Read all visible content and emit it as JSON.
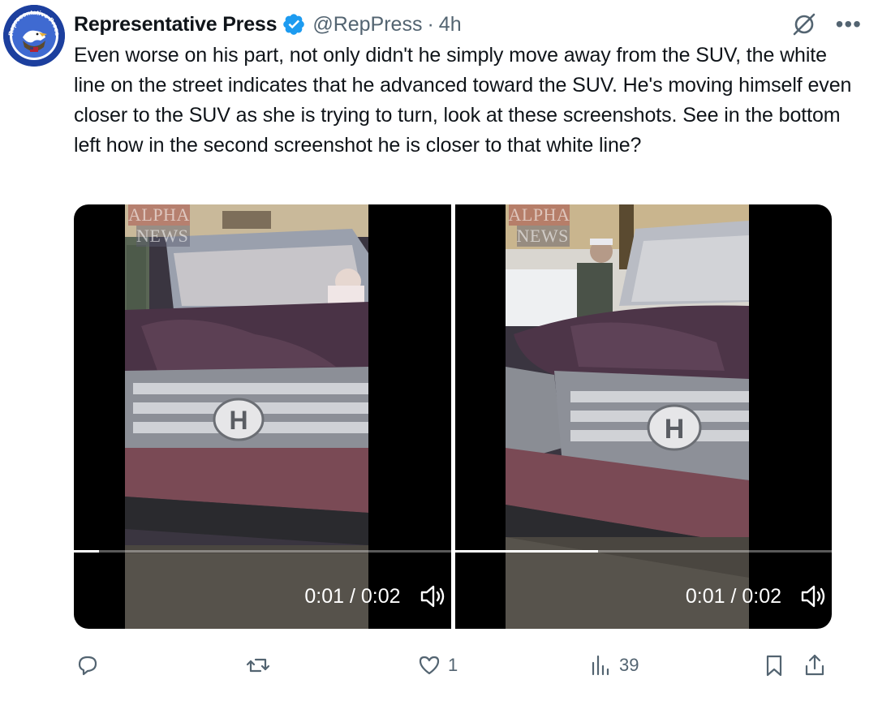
{
  "tweet": {
    "display_name": "Representative Press",
    "handle": "@RepPress",
    "separator": "·",
    "time": "4h",
    "more_icon": "more-icon",
    "verified_icon": "verified-badge-icon",
    "text": "Even worse on his part, not only didn't he simply move away from the SUV, the white line on the street indicates that he advanced toward the SUV. He's moving himself even closer to the SUV as she is trying to turn, look at these screenshots. See in the bottom left how in the second screenshot he is closer to that white line?",
    "avatar_text": "Representative Press"
  },
  "media": {
    "videos": [
      {
        "watermark_line1": "ALPHA",
        "watermark_line2": "NEWS",
        "time_display": "0:01 / 0:02",
        "progress": 0.066
      },
      {
        "watermark_line1": "ALPHA",
        "watermark_line2": "NEWS",
        "time_display": "0:01 / 0:02",
        "progress": 0.38
      }
    ]
  },
  "actions": {
    "reply_count": "",
    "repost_count": "",
    "like_count": "1",
    "views_count": "39"
  },
  "colors": {
    "text": "#0f1419",
    "secondary": "#536471",
    "verified": "#1d9bf0",
    "avatar_bg": "#1c3f9e"
  }
}
